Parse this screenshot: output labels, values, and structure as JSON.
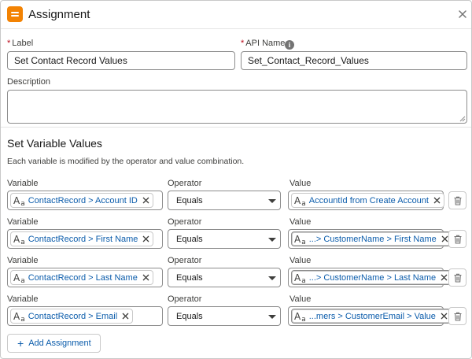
{
  "header": {
    "title": "Assignment"
  },
  "form": {
    "label_label": "Label",
    "label_value": "Set Contact Record Values",
    "api_label": "API Name",
    "api_value": "Set_Contact_Record_Values",
    "description_label": "Description",
    "description_value": "",
    "required_marker": "*",
    "info_glyph": "i"
  },
  "section": {
    "title": "Set Variable Values",
    "description": "Each variable is modified by the operator and value combination."
  },
  "columns": {
    "variable": "Variable",
    "operator": "Operator",
    "value": "Value"
  },
  "rows": [
    {
      "variable": "ContactRecord > Account ID",
      "operator": "Equals",
      "value": "AccountId from Create Account"
    },
    {
      "variable": "ContactRecord > First Name",
      "operator": "Equals",
      "value": "...> CustomerName > First Name"
    },
    {
      "variable": "ContactRecord > Last Name",
      "operator": "Equals",
      "value": "...> CustomerName > Last Name"
    },
    {
      "variable": "ContactRecord > Email",
      "operator": "Equals",
      "value": "...mers > CustomerEmail > Value"
    }
  ],
  "type_icon": {
    "big": "A",
    "small": "a"
  },
  "add_button": {
    "plus": "+",
    "label": "Add Assignment"
  },
  "colors": {
    "accent": "#f38303",
    "link": "#0b5cab",
    "required": "#ba0517"
  },
  "icons": [
    "assignment-icon",
    "close-icon",
    "info-icon",
    "text-type-icon",
    "remove-icon",
    "chevron-down-icon",
    "trash-icon",
    "plus-icon"
  ]
}
